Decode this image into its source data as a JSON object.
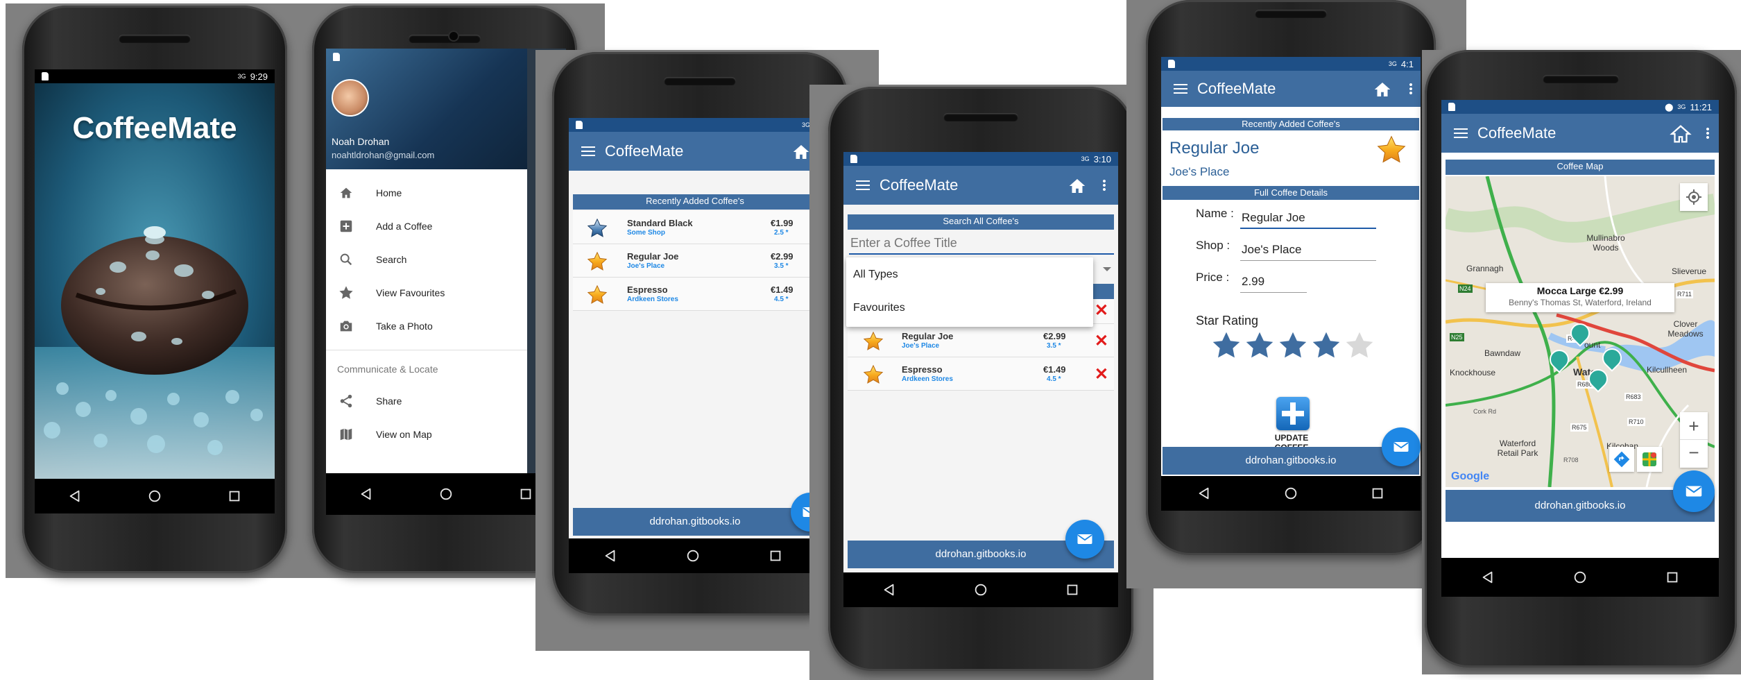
{
  "app": {
    "title": "CoffeeMate",
    "footer": "ddrohan.gitbooks.io",
    "splash_title": "CoffeeMate"
  },
  "status": {
    "signal": "3G",
    "time1": "9:29",
    "time4": "3:10",
    "time5": "4:1",
    "time6": "11:21"
  },
  "drawer": {
    "user_name": "Noah Drohan",
    "user_email": "noahtldrohan@gmail.com",
    "items": [
      {
        "label": "Home",
        "icon": "home-icon"
      },
      {
        "label": "Add a Coffee",
        "icon": "add-box-icon"
      },
      {
        "label": "Search",
        "icon": "search-icon"
      },
      {
        "label": "View Favourites",
        "icon": "star-icon"
      },
      {
        "label": "Take a Photo",
        "icon": "camera-icon"
      }
    ],
    "section_header": "Communicate & Locate",
    "section_items": [
      {
        "label": "Share",
        "icon": "share-icon"
      },
      {
        "label": "View on Map",
        "icon": "map-icon"
      }
    ]
  },
  "home": {
    "section": "Recently Added Coffee's",
    "coffees": [
      {
        "name": "Standard Black",
        "shop": "Some Shop",
        "price": "€1.99",
        "rating": "2.5 *",
        "favourite": false
      },
      {
        "name": "Regular Joe",
        "shop": "Joe's Place",
        "price": "€2.99",
        "rating": "3.5 *",
        "favourite": true
      },
      {
        "name": "Espresso",
        "shop": "Ardkeen Stores",
        "price": "€1.49",
        "rating": "4.5 *",
        "favourite": true
      }
    ]
  },
  "search": {
    "section": "Search All Coffee's",
    "placeholder": "Enter a Coffee Title",
    "dropdown_options": [
      "All Types",
      "Favourites"
    ],
    "results": [
      {
        "name": "Regular Joe",
        "shop": "Joe's Place",
        "price": "€2.99",
        "rating": "3.5 *"
      },
      {
        "name": "Espresso",
        "shop": "Ardkeen Stores",
        "price": "€1.49",
        "rating": "4.5 *"
      }
    ]
  },
  "details": {
    "section": "Recently Added Coffee's",
    "coffee_name": "Regular Joe",
    "coffee_shop": "Joe's Place",
    "full_section": "Full Coffee Details",
    "name_label": "Name :",
    "name_value": "Regular Joe",
    "shop_label": "Shop :",
    "shop_value": "Joe's Place",
    "price_label": "Price :",
    "price_value": "2.99",
    "star_label": "Star Rating",
    "stars_filled": 4,
    "stars_total": 5,
    "update_label": "UPDATE COFFEE"
  },
  "map": {
    "section": "Coffee Map",
    "info_title": "Mocca Large €2.99",
    "info_address": "Benny's Thomas St, Waterford, Ireland",
    "places": [
      "Mullinabro Woods",
      "Grannagh",
      "Slieverue",
      "Clover Meadows",
      "Bawndaw",
      "Knockhouse",
      "Wate",
      "Kilcullheen",
      "Waterford Retail Park",
      "Kilcohan",
      "ount"
    ],
    "roads": [
      "N24",
      "R711",
      "N25",
      "R448",
      "R680",
      "R683",
      "R675",
      "R710",
      "Cork Rd",
      "R708"
    ],
    "logo": "Google",
    "zoom_in": "+",
    "zoom_out": "−"
  },
  "colors": {
    "primary": "#3f6da0",
    "accent": "#1e88e5",
    "delete": "#e21b1b",
    "star": "#f5a623"
  }
}
